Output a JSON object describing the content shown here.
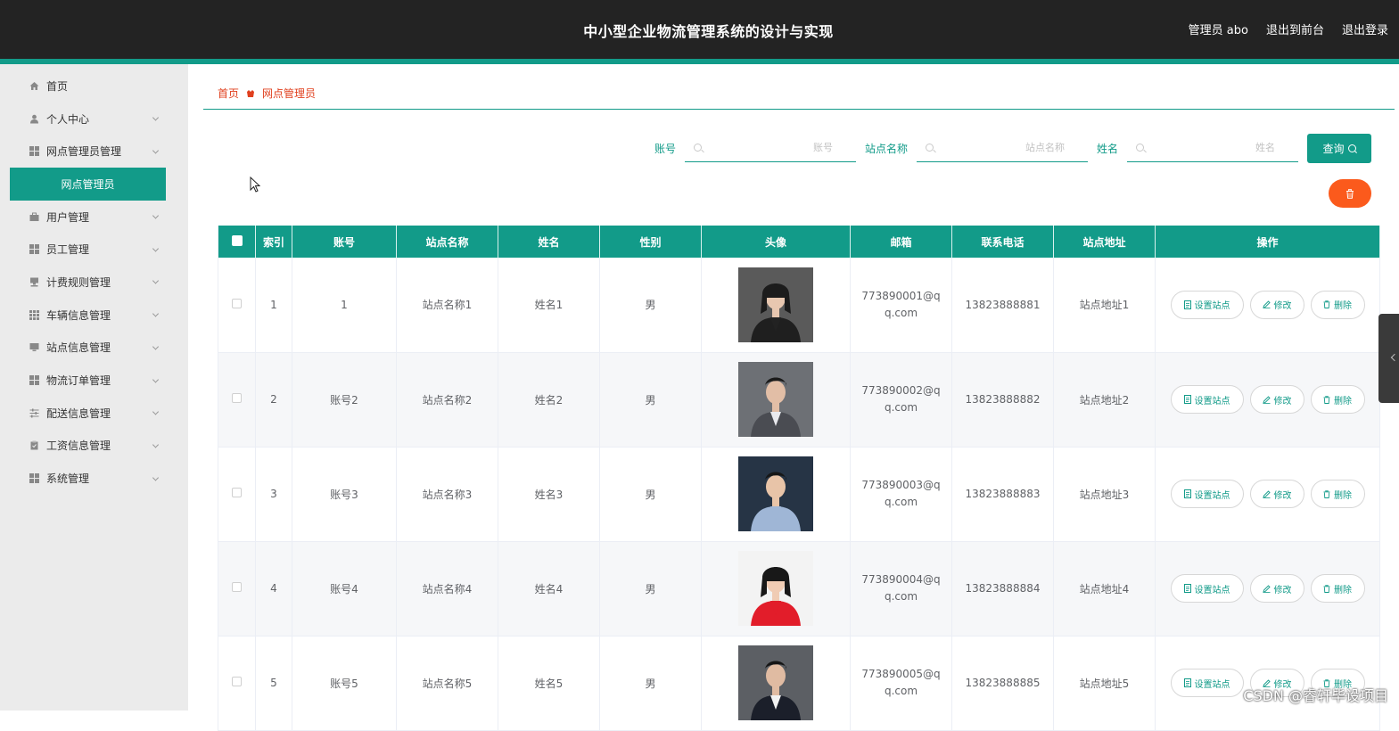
{
  "header": {
    "title": "中小型企业物流管理系统的设计与实现",
    "admin_label": "管理员 abo",
    "exit_front": "退出到前台",
    "logout": "退出登录"
  },
  "sidebar": {
    "items": [
      {
        "label": "首页",
        "icon": "home-icon"
      },
      {
        "label": "个人中心",
        "icon": "person-icon"
      },
      {
        "label": "网点管理员管理",
        "icon": "grid-icon"
      },
      {
        "label": "网点管理员",
        "icon": ""
      },
      {
        "label": "用户管理",
        "icon": "briefcase-icon"
      },
      {
        "label": "员工管理",
        "icon": "grid-icon"
      },
      {
        "label": "计费规则管理",
        "icon": "stamp-icon"
      },
      {
        "label": "车辆信息管理",
        "icon": "grid9-icon"
      },
      {
        "label": "站点信息管理",
        "icon": "monitor-icon"
      },
      {
        "label": "物流订单管理",
        "icon": "grid-icon"
      },
      {
        "label": "配送信息管理",
        "icon": "sliders-icon"
      },
      {
        "label": "工资信息管理",
        "icon": "clipboard-icon"
      },
      {
        "label": "系统管理",
        "icon": "grid-icon"
      }
    ]
  },
  "breadcrumb": {
    "home": "首页",
    "current": "网点管理员"
  },
  "search": {
    "account_label": "账号",
    "account_placeholder": "账号",
    "station_label": "站点名称",
    "station_placeholder": "站点名称",
    "name_label": "姓名",
    "name_placeholder": "姓名",
    "query_button": "查询"
  },
  "table": {
    "headers": [
      "索引",
      "账号",
      "站点名称",
      "姓名",
      "性别",
      "头像",
      "邮箱",
      "联系电话",
      "站点地址",
      "操作"
    ],
    "rows": [
      {
        "index": "1",
        "account": "1",
        "station": "站点名称1",
        "name": "姓名1",
        "gender": "男",
        "email": "773890001@qq.com",
        "phone": "13823888881",
        "address": "站点地址1"
      },
      {
        "index": "2",
        "account": "账号2",
        "station": "站点名称2",
        "name": "姓名2",
        "gender": "男",
        "email": "773890002@qq.com",
        "phone": "13823888882",
        "address": "站点地址2"
      },
      {
        "index": "3",
        "account": "账号3",
        "station": "站点名称3",
        "name": "姓名3",
        "gender": "男",
        "email": "773890003@qq.com",
        "phone": "13823888883",
        "address": "站点地址3"
      },
      {
        "index": "4",
        "account": "账号4",
        "station": "站点名称4",
        "name": "姓名4",
        "gender": "男",
        "email": "773890004@qq.com",
        "phone": "13823888884",
        "address": "站点地址4"
      },
      {
        "index": "5",
        "account": "账号5",
        "station": "站点名称5",
        "name": "姓名5",
        "gender": "男",
        "email": "773890005@qq.com",
        "phone": "13823888885",
        "address": "站点地址5"
      }
    ],
    "actions": {
      "set_station": "设置站点",
      "edit": "修改",
      "delete": "删除"
    }
  },
  "watermark": "CSDN @睿轩毕设项目",
  "colors": {
    "accent": "#129b89",
    "header_bg": "#232323",
    "danger": "#fb5a1c",
    "breadcrumb": "#e0401f"
  }
}
